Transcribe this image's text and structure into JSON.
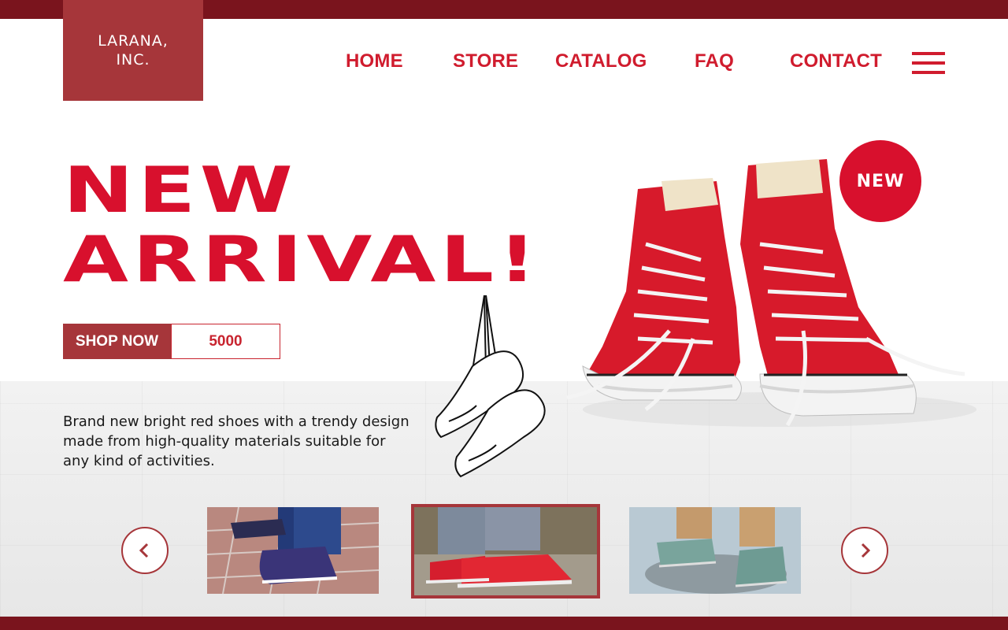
{
  "brand": {
    "line1": "LARANA,",
    "line2": "INC."
  },
  "nav": {
    "items": [
      "HOME",
      "STORE",
      "CATALOG",
      "FAQ",
      "CONTACT"
    ],
    "menu_icon": "hamburger-menu-icon"
  },
  "hero": {
    "title_line1": "NEW",
    "title_line2": "ARRIVAL!",
    "shop_now_label": "SHOP NOW",
    "price": "5000",
    "description": "Brand new bright red shoes with a trendy design made from high-quality materials suitable for any kind of activities.",
    "badge": "NEW"
  },
  "carousel": {
    "prev_icon": "chevron-left-icon",
    "next_icon": "chevron-right-icon",
    "selected_index": 1
  },
  "colors": {
    "dark_red": "#7a141d",
    "brand_red": "#a6363a",
    "accent_red": "#d8102d",
    "nav_red": "#d01c2e"
  }
}
